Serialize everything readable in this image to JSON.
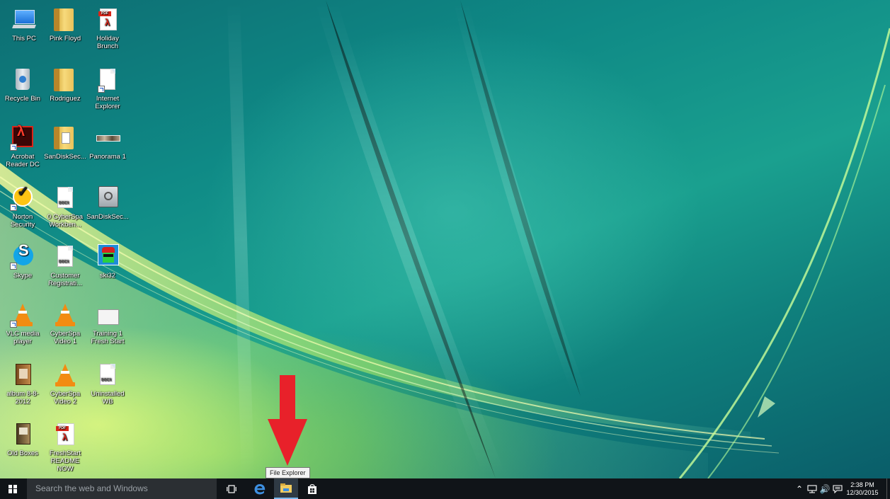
{
  "desktop": {
    "icons": [
      {
        "id": "this-pc",
        "label": "This PC",
        "kind": "pc"
      },
      {
        "id": "pink-floyd",
        "label": "Pink Floyd",
        "kind": "folder"
      },
      {
        "id": "holiday-brunch",
        "label": "Holiday Brunch",
        "kind": "pdf",
        "tag": "PDF"
      },
      {
        "id": "recycle-bin",
        "label": "Recycle Bin",
        "kind": "recycle"
      },
      {
        "id": "rodriguez",
        "label": "Rodriguez",
        "kind": "folder"
      },
      {
        "id": "internet-explorer",
        "label": "Internet Explorer",
        "kind": "doc-shortcut"
      },
      {
        "id": "acrobat-reader-dc",
        "label": "Acrobat Reader DC",
        "kind": "acrobat"
      },
      {
        "id": "sandisksec-1",
        "label": "SanDiskSec...",
        "kind": "folder-file"
      },
      {
        "id": "panorama-1",
        "label": "Panorama 1",
        "kind": "panorama"
      },
      {
        "id": "norton-security",
        "label": "Norton Security",
        "kind": "norton"
      },
      {
        "id": "cyberspa-workbench",
        "label": "0 CyberSpa Workben...",
        "kind": "docx",
        "tag": "DOCX"
      },
      {
        "id": "sandisksec-2",
        "label": "SanDiskSec...",
        "kind": "vault"
      },
      {
        "id": "skype",
        "label": "Skype",
        "kind": "skype"
      },
      {
        "id": "customer-registration",
        "label": "Customer Registrati...",
        "kind": "docx",
        "tag": "DOCX"
      },
      {
        "id": "ski32",
        "label": "ski32",
        "kind": "ski"
      },
      {
        "id": "vlc-media-player",
        "label": "VLC media player",
        "kind": "vlc"
      },
      {
        "id": "cyberspa-video-1",
        "label": "CyberSpa Video 1",
        "kind": "vlc"
      },
      {
        "id": "training-1-fresh-start",
        "label": "Training 1 Fresh Start",
        "kind": "blank"
      },
      {
        "id": "album-8-8-2012",
        "label": "album 8-8-2012",
        "kind": "album"
      },
      {
        "id": "cyberspa-video-2",
        "label": "CyberSpa Video 2",
        "kind": "vlc"
      },
      {
        "id": "uninstalled-wb",
        "label": "Uninstalled WB",
        "kind": "docx",
        "tag": "DOCX"
      },
      {
        "id": "old-boxes",
        "label": "Old Boxes",
        "kind": "oldboxes"
      },
      {
        "id": "freshstart-readme-now",
        "label": "FreshStart README NOW",
        "kind": "pdf",
        "tag": "PDF"
      }
    ]
  },
  "taskbar": {
    "search_placeholder": "Search the web and Windows",
    "pinned": [
      {
        "id": "task-view",
        "name": "task-view-icon"
      },
      {
        "id": "edge",
        "name": "edge-icon"
      },
      {
        "id": "file-explorer",
        "name": "file-explorer-icon"
      },
      {
        "id": "store",
        "name": "store-icon"
      }
    ],
    "tray": {
      "time": "2:38 PM",
      "date": "12/30/2015"
    }
  },
  "tooltip": {
    "text": "File Explorer"
  },
  "colors": {
    "taskbar": "#101418",
    "search_box": "#2b2f33",
    "arrow": "#e8212a",
    "edge": "#3d8fe0",
    "folder": "#f0cc60"
  }
}
